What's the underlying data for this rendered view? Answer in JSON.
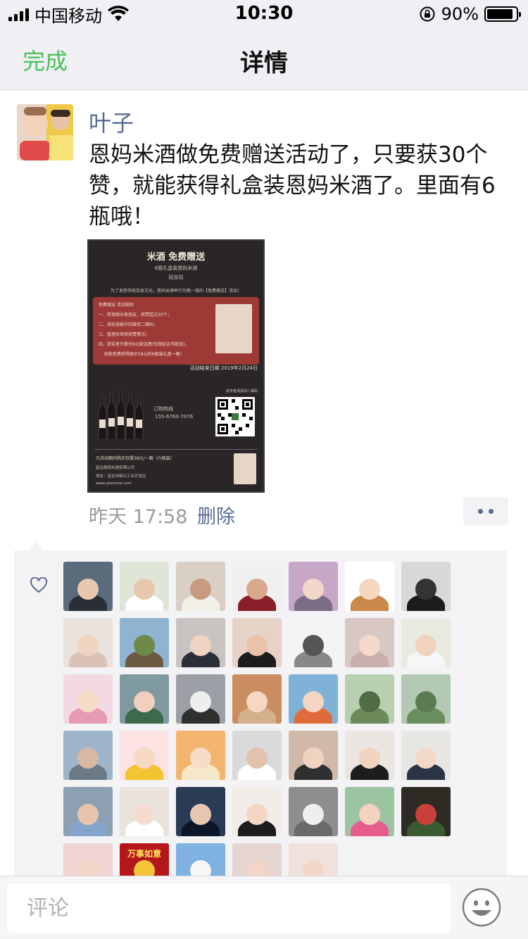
{
  "status_bar": {
    "carrier": "中国移动",
    "time": "10:30",
    "battery_percent": "90%",
    "battery_level": 0.9
  },
  "nav": {
    "done_label": "完成",
    "title": "详情"
  },
  "post": {
    "author": "叶子",
    "text": "恩妈米酒做免费赠送活动了，只要获30个赞，就能获得礼盒装恩妈米酒了。里面有6瓶哦！",
    "time": "昨天 17:58",
    "delete_label": "删除"
  },
  "poster": {
    "title": "米酒 免费赠送",
    "subtitle": "6瓶礼盒装恩妈米酒",
    "location": "延吉站",
    "intro": "为了发扬传统饮食文化，恩妈米酒举行为期一周的【免费赠送】活动！",
    "rules": [
      "免费赠送 活动规则",
      "一、转发图分享朋友，获赞超过30个；",
      "二、添加海报中的微信二维码；",
      "三、管理员审核获赞情况；",
      "四、获奖者只需付8元配送费(仅限延吉市配送)，",
      "就能免费获得原价58元的6瓶装礼盒一箱！"
    ],
    "end_date": "活动结束日期 2019年2月24日",
    "hotline_label": "订购热线",
    "hotline": "155-6760-7076",
    "qr_caption": "获奖者请添加二维码",
    "footer": [
      "凡活动期间购买仅需38元/一箱（六瓶装）",
      "延边恩妈米酒有限公司",
      "地址：延吉市新兴工业开发区",
      "www.ybenma.com"
    ]
  },
  "likes": {
    "avatars": [
      {
        "label": "",
        "bg": "#5a6b7c",
        "face": "#e8c9b0",
        "body": "#2a2f36"
      },
      {
        "label": "",
        "bg": "#dfe6d8",
        "face": "#e7c7ae",
        "body": "#ffffff"
      },
      {
        "label": "",
        "bg": "#d9cfc4",
        "face": "#c99a82",
        "body": "#f2eee8"
      },
      {
        "label": "",
        "bg": "#f0f0f0",
        "face": "#d8a98c",
        "body": "#8a1f2a"
      },
      {
        "label": "",
        "bg": "#c7a7c8",
        "face": "#f2d6c9",
        "body": "#7c6c86"
      },
      {
        "label": "",
        "bg": "#ffffff",
        "face": "#f5d7c0",
        "body": "#c8894a"
      },
      {
        "label": "",
        "bg": "#d8d8d8",
        "face": "#333333",
        "body": "#1c1c1c"
      },
      {
        "label": "",
        "bg": "#e9e2dc",
        "face": "#f1d3c2",
        "body": "#d9c2b6"
      },
      {
        "label": "",
        "bg": "#8fb3d1",
        "face": "#6e8a4a",
        "body": "#6d5a42"
      },
      {
        "label": "",
        "bg": "#c9c4c2",
        "face": "#f0d4c4",
        "body": "#2b2f3a"
      },
      {
        "label": "",
        "bg": "#e7d2c7",
        "face": "#e9c2ac",
        "body": "#1d1d1d"
      },
      {
        "label": "",
        "bg": "#f4f4f4",
        "face": "#555555",
        "body": "#888888"
      },
      {
        "label": "",
        "bg": "#d9c7c4",
        "face": "#f3d8cc",
        "body": "#c7b0ab"
      },
      {
        "label": "",
        "bg": "#e9eadf",
        "face": "#f0d2bd",
        "body": "#f6f6f6"
      },
      {
        "label": "",
        "bg": "#f3d9e3",
        "face": "#f7dcc8",
        "body": "#e69ab6"
      },
      {
        "label": "",
        "bg": "#7f9aa1",
        "face": "#f1cfc0",
        "body": "#3c6a4a"
      },
      {
        "label": "",
        "bg": "#9aa0a6",
        "face": "#eeeeee",
        "body": "#2f2f2f"
      },
      {
        "label": "",
        "bg": "#c98d61",
        "face": "#f5d7c3",
        "body": "#d4b08a"
      },
      {
        "label": "",
        "bg": "#7fb2d6",
        "face": "#f3d5c2",
        "body": "#e06b3a"
      },
      {
        "label": "",
        "bg": "#b8cfb0",
        "face": "#4f6d45",
        "body": "#6d8b5a"
      },
      {
        "label": "",
        "bg": "#b4c9b3",
        "face": "#5a7c50",
        "body": "#6b8e5f"
      },
      {
        "label": "",
        "bg": "#9eb5c9",
        "face": "#d7b8a2",
        "body": "#6c7a88"
      },
      {
        "label": "",
        "bg": "#fbe3e3",
        "face": "#f7d8c5",
        "body": "#f3c432"
      },
      {
        "label": "",
        "bg": "#f2b46e",
        "face": "#f7dcc8",
        "body": "#f6e7c8"
      },
      {
        "label": "",
        "bg": "#d8dadc",
        "face": "#e2c2ad",
        "body": "#ffffff"
      },
      {
        "label": "",
        "bg": "#d0b9a9",
        "face": "#f0d2c0",
        "body": "#2f2f2f"
      },
      {
        "label": "",
        "bg": "#ece6e2",
        "face": "#f1d3c2",
        "body": "#1d1d1d"
      },
      {
        "label": "",
        "bg": "#e9e7e4",
        "face": "#f2d8c8",
        "body": "#2a3446"
      },
      {
        "label": "",
        "bg": "#8ca0b2",
        "face": "#e7c4ad",
        "body": "#85a5cc"
      },
      {
        "label": "",
        "bg": "#e9e3dc",
        "face": "#f4dcd0",
        "body": "#ffffff"
      },
      {
        "label": "",
        "bg": "#2b3a55",
        "face": "#e7c7b2",
        "body": "#0d1626"
      },
      {
        "label": "",
        "bg": "#f2ece8",
        "face": "#f2d6c6",
        "body": "#1d1d1d"
      },
      {
        "label": "",
        "bg": "#8e8e8e",
        "face": "#eeeeee",
        "body": "#6a6a6a"
      },
      {
        "label": "",
        "bg": "#9cc3a2",
        "face": "#f3d3c0",
        "body": "#e65c8c"
      },
      {
        "label": "",
        "bg": "#2e2a24",
        "face": "#c9413a",
        "body": "#3a5a32"
      },
      {
        "label": "",
        "bg": "#efd4d2",
        "face": "#f3d5c5",
        "body": "#f2e7e6"
      },
      {
        "label": "万事如意",
        "bg": "#b5161b",
        "face": "#f2c53d",
        "body": "#7a0c10"
      },
      {
        "label": "",
        "bg": "#7fb2e0",
        "face": "#f6f6f6",
        "body": "#ffffff"
      },
      {
        "label": "",
        "bg": "#e6d5d0",
        "face": "#f2d5c6",
        "body": "#2b2b2b"
      },
      {
        "label": "",
        "bg": "#f0e2da",
        "face": "#f3d6c6",
        "body": "#e9b2b2"
      }
    ]
  },
  "comment_bar": {
    "placeholder": "评论"
  },
  "icons": {
    "heart": "heart-outline-icon",
    "emoji": "smiley-icon",
    "wifi": "wifi-icon",
    "rotation_lock": "rotation-lock-icon"
  },
  "colors": {
    "accent_green": "#4cc05b",
    "link_blue": "#576b95",
    "meta_gray": "#9b9b9b",
    "bar_bg": "#efeff4"
  }
}
